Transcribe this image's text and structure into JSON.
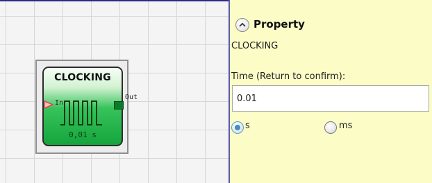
{
  "canvas": {
    "block": {
      "title": "CLOCKING",
      "input_label": "In",
      "output_label": "Out",
      "value": "0,01 s"
    }
  },
  "property_panel": {
    "title": "Property",
    "component_name": "CLOCKING",
    "time_field": {
      "label": "Time (Return to confirm):",
      "value": "0.01"
    },
    "unit_options": [
      {
        "label": "s",
        "selected": true
      },
      {
        "label": "ms",
        "selected": false
      }
    ]
  },
  "icons": {
    "collapse": "chevron-up-icon",
    "input_port": "input-arrow-icon",
    "output_port": "output-port-icon",
    "pulse": "pulse-wave-icon"
  },
  "colors": {
    "block_green": "#1fae47",
    "panel_background": "#fcfcc7",
    "input_arrow": "#e8434f",
    "radio_selected": "#3f8ec4"
  }
}
